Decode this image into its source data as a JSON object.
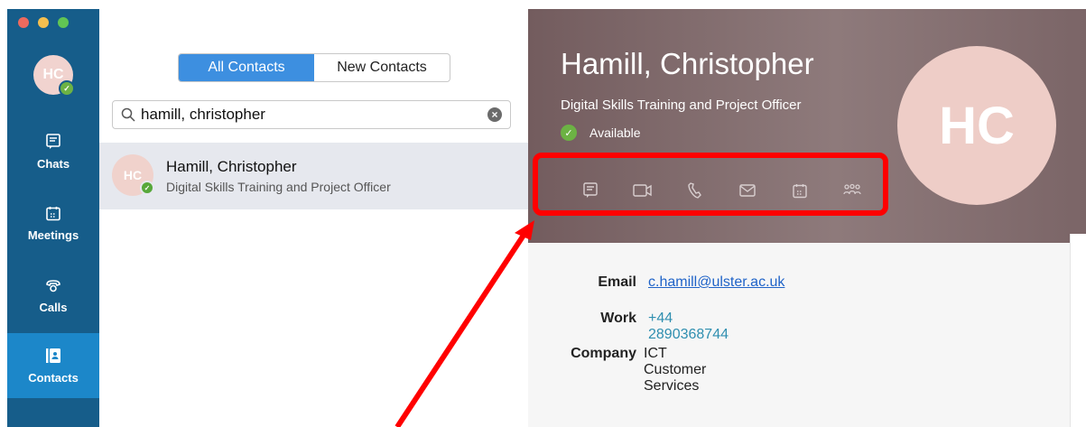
{
  "window": {
    "controls": [
      "close",
      "minimize",
      "zoom"
    ]
  },
  "sidebar": {
    "avatar_initials": "HC",
    "items": [
      {
        "label": "Chats",
        "icon": "chat-icon"
      },
      {
        "label": "Meetings",
        "icon": "calendar-icon"
      },
      {
        "label": "Calls",
        "icon": "phone-icon"
      },
      {
        "label": "Contacts",
        "icon": "contacts-icon",
        "active": true
      }
    ]
  },
  "list": {
    "tabs": [
      {
        "label": "All Contacts",
        "selected": true
      },
      {
        "label": "New Contacts",
        "selected": false
      }
    ],
    "search": {
      "value": "hamill, christopher"
    },
    "results": [
      {
        "initials": "HC",
        "name": "Hamill, Christopher",
        "title": "Digital Skills Training and Project Officer"
      }
    ]
  },
  "profile": {
    "name": "Hamill, Christopher",
    "title": "Digital Skills Training and Project Officer",
    "status": "Available",
    "initials": "HC",
    "actions": [
      "chat-icon",
      "video-icon",
      "phone-icon",
      "email-icon",
      "meeting-icon",
      "group-icon"
    ],
    "details": [
      {
        "label": "Email",
        "value": "c.hamill@ulster.ac.uk"
      },
      {
        "label": "Work",
        "value": "+44 2890368744"
      },
      {
        "label": "Company",
        "value": "ICT Customer Services"
      }
    ]
  },
  "colors": {
    "rail": "#165d8a",
    "rail_active": "#1c87c9",
    "tab_selected": "#3d8fe0",
    "presence": "#6cb244",
    "header": "#7f6a6c",
    "annotation": "#ff0000"
  }
}
